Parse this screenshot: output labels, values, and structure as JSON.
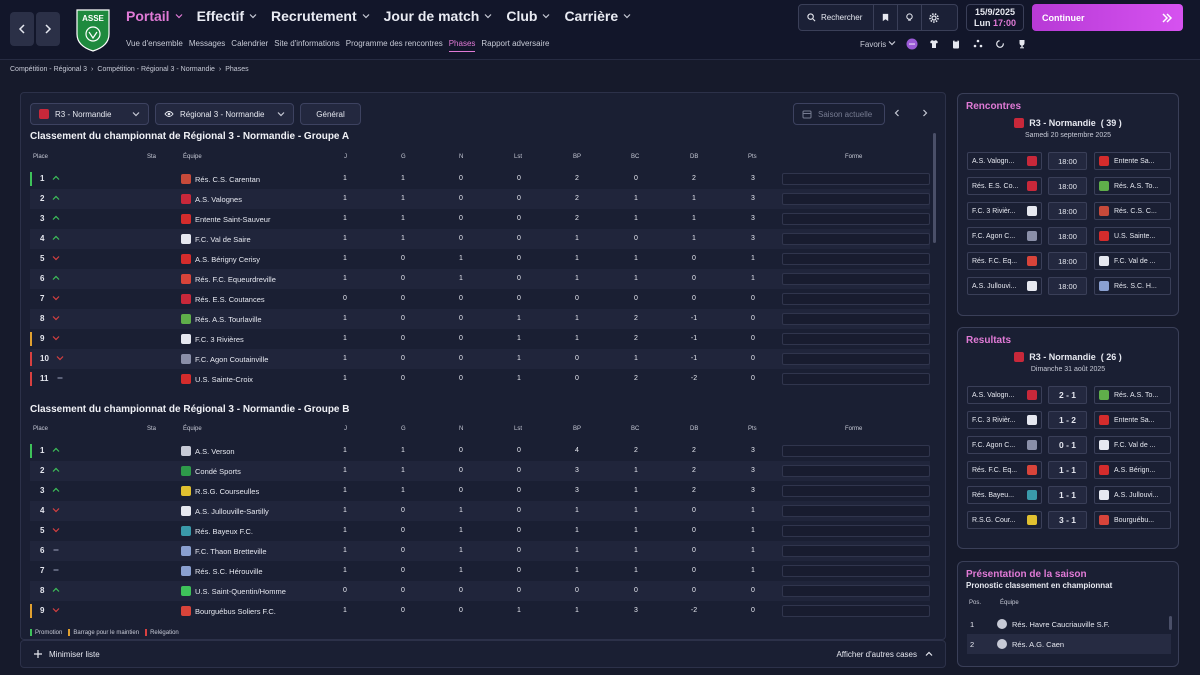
{
  "topbar": {
    "main_nav": [
      "Portail",
      "Effectif",
      "Recrutement",
      "Jour de match",
      "Club",
      "Carrière"
    ],
    "sub_nav": [
      "Vue d'ensemble",
      "Messages",
      "Calendrier",
      "Site d'informations",
      "Programme des rencontres",
      "Phases",
      "Rapport adversaire"
    ],
    "active_sub": "Phases",
    "search_label": "Rechercher",
    "date": "15/9/2025",
    "day_time": "Lun",
    "time": "17:00",
    "continue_label": "Continuer",
    "favoris_label": "Favoris",
    "logo_text": "ASSE"
  },
  "breadcrumb": [
    "Compétition - Régional 3",
    "Compétition - Régional 3 - Normandie",
    "Phases"
  ],
  "filters": {
    "comp": "R3 - Normandie",
    "view": "Régional 3 - Normandie",
    "mode": "Général",
    "season": "Saison actuelle"
  },
  "columns": [
    "Place",
    "Sta",
    "Équipe",
    "J",
    "G",
    "N",
    "Lst",
    "BP",
    "BC",
    "DB",
    "Pts",
    "Forme"
  ],
  "groupA": {
    "title": "Classement du championnat de Régional 3 - Normandie - Groupe A",
    "rows": [
      {
        "place": "1",
        "mv": "up",
        "bar": "#3ec25a",
        "team": "Rés. C.S. Carentan",
        "crest": "#c74a3a",
        "J": "1",
        "G": "1",
        "N": "0",
        "Lst": "0",
        "BP": "2",
        "BC": "0",
        "DB": "2",
        "Pts": "3"
      },
      {
        "place": "2",
        "mv": "up",
        "bar": "",
        "team": "A.S. Valognes",
        "crest": "#c8283a",
        "J": "1",
        "G": "1",
        "N": "0",
        "Lst": "0",
        "BP": "2",
        "BC": "1",
        "DB": "1",
        "Pts": "3"
      },
      {
        "place": "3",
        "mv": "up",
        "bar": "",
        "team": "Entente Saint-Sauveur",
        "crest": "#d42c2c",
        "J": "1",
        "G": "1",
        "N": "0",
        "Lst": "0",
        "BP": "2",
        "BC": "1",
        "DB": "1",
        "Pts": "3"
      },
      {
        "place": "4",
        "mv": "up",
        "bar": "",
        "team": "F.C. Val de Saire",
        "crest": "#e6e8f0",
        "J": "1",
        "G": "1",
        "N": "0",
        "Lst": "0",
        "BP": "1",
        "BC": "0",
        "DB": "1",
        "Pts": "3"
      },
      {
        "place": "5",
        "mv": "down",
        "bar": "",
        "team": "A.S. Bérigny Cerisy",
        "crest": "#d42c2c",
        "J": "1",
        "G": "0",
        "N": "1",
        "Lst": "0",
        "BP": "1",
        "BC": "1",
        "DB": "0",
        "Pts": "1"
      },
      {
        "place": "6",
        "mv": "up",
        "bar": "",
        "team": "Rés. F.C. Equeurdreville",
        "crest": "#d8443a",
        "J": "1",
        "G": "0",
        "N": "1",
        "Lst": "0",
        "BP": "1",
        "BC": "1",
        "DB": "0",
        "Pts": "1"
      },
      {
        "place": "7",
        "mv": "down",
        "bar": "",
        "team": "Rés. E.S. Coutances",
        "crest": "#c8283a",
        "J": "0",
        "G": "0",
        "N": "0",
        "Lst": "0",
        "BP": "0",
        "BC": "0",
        "DB": "0",
        "Pts": "0"
      },
      {
        "place": "8",
        "mv": "down",
        "bar": "",
        "team": "Rés. A.S. Tourlaville",
        "crest": "#5fae4a",
        "J": "1",
        "G": "0",
        "N": "0",
        "Lst": "1",
        "BP": "1",
        "BC": "2",
        "DB": "-1",
        "Pts": "0"
      },
      {
        "place": "9",
        "mv": "down",
        "bar": "#e0a030",
        "team": "F.C. 3 Rivières",
        "crest": "#e6e8f0",
        "J": "1",
        "G": "0",
        "N": "0",
        "Lst": "1",
        "BP": "1",
        "BC": "2",
        "DB": "-1",
        "Pts": "0"
      },
      {
        "place": "10",
        "mv": "down",
        "bar": "#d84040",
        "team": "F.C. Agon Coutainville",
        "crest": "#8a8fa8",
        "J": "1",
        "G": "0",
        "N": "0",
        "Lst": "1",
        "BP": "0",
        "BC": "1",
        "DB": "-1",
        "Pts": "0"
      },
      {
        "place": "11",
        "mv": "same",
        "bar": "#d84040",
        "team": "U.S. Sainte-Croix",
        "crest": "#d42c2c",
        "J": "1",
        "G": "0",
        "N": "0",
        "Lst": "1",
        "BP": "0",
        "BC": "2",
        "DB": "-2",
        "Pts": "0"
      }
    ]
  },
  "groupB": {
    "title": "Classement du championnat de Régional 3 - Normandie - Groupe B",
    "rows": [
      {
        "place": "1",
        "mv": "up",
        "bar": "#3ec25a",
        "team": "A.S. Verson",
        "crest": "#c7cad6",
        "J": "1",
        "G": "1",
        "N": "0",
        "Lst": "0",
        "BP": "4",
        "BC": "2",
        "DB": "2",
        "Pts": "3"
      },
      {
        "place": "2",
        "mv": "up",
        "bar": "",
        "team": "Condé Sports",
        "crest": "#2e9a4a",
        "J": "1",
        "G": "1",
        "N": "0",
        "Lst": "0",
        "BP": "3",
        "BC": "1",
        "DB": "2",
        "Pts": "3"
      },
      {
        "place": "3",
        "mv": "up",
        "bar": "",
        "team": "R.S.G. Courseulles",
        "crest": "#e0c030",
        "J": "1",
        "G": "1",
        "N": "0",
        "Lst": "0",
        "BP": "3",
        "BC": "1",
        "DB": "2",
        "Pts": "3"
      },
      {
        "place": "4",
        "mv": "down",
        "bar": "",
        "team": "A.S. Jullouville-Sartilly",
        "crest": "#e6e8f0",
        "J": "1",
        "G": "0",
        "N": "1",
        "Lst": "0",
        "BP": "1",
        "BC": "1",
        "DB": "0",
        "Pts": "1"
      },
      {
        "place": "5",
        "mv": "down",
        "bar": "",
        "team": "Rés. Bayeux F.C.",
        "crest": "#3a9aaa",
        "J": "1",
        "G": "0",
        "N": "1",
        "Lst": "0",
        "BP": "1",
        "BC": "1",
        "DB": "0",
        "Pts": "1"
      },
      {
        "place": "6",
        "mv": "same",
        "bar": "",
        "team": "F.C. Thaon Bretteville",
        "crest": "#8aa0d0",
        "J": "1",
        "G": "0",
        "N": "1",
        "Lst": "0",
        "BP": "1",
        "BC": "1",
        "DB": "0",
        "Pts": "1"
      },
      {
        "place": "7",
        "mv": "same",
        "bar": "",
        "team": "Rés. S.C. Hérouville",
        "crest": "#8aa0d0",
        "J": "1",
        "G": "0",
        "N": "1",
        "Lst": "0",
        "BP": "1",
        "BC": "1",
        "DB": "0",
        "Pts": "1"
      },
      {
        "place": "8",
        "mv": "up",
        "bar": "",
        "team": "U.S. Saint-Quentin/Homme",
        "crest": "#3ec25a",
        "J": "0",
        "G": "0",
        "N": "0",
        "Lst": "0",
        "BP": "0",
        "BC": "0",
        "DB": "0",
        "Pts": "0"
      },
      {
        "place": "9",
        "mv": "down",
        "bar": "#e0a030",
        "team": "Bourguébus Soliers F.C.",
        "crest": "#d8443a",
        "J": "1",
        "G": "0",
        "N": "0",
        "Lst": "1",
        "BP": "1",
        "BC": "3",
        "DB": "-2",
        "Pts": "0"
      }
    ]
  },
  "legend": {
    "promotion": "Promotion",
    "barrage": "Barrage pour le maintien",
    "relegation": "Relégation"
  },
  "bottombar": {
    "minimize": "Minimiser liste",
    "more": "Afficher d'autres cases"
  },
  "rencontres": {
    "title": "Rencontres",
    "comp": "R3 - Normandie",
    "round": "( 39 )",
    "date": "Samedi 20 septembre 2025",
    "matches": [
      {
        "home": "A.S. Valogn...",
        "hc": "#c8283a",
        "mid": "18:00",
        "away": "Entente Sa...",
        "ac": "#d42c2c"
      },
      {
        "home": "Rés. E.S. Co...",
        "hc": "#c8283a",
        "mid": "18:00",
        "away": "Rés. A.S. To...",
        "ac": "#5fae4a"
      },
      {
        "home": "F.C. 3 Rivièr...",
        "hc": "#e6e8f0",
        "mid": "18:00",
        "away": "Rés. C.S. C...",
        "ac": "#c74a3a"
      },
      {
        "home": "F.C. Agon C...",
        "hc": "#8a8fa8",
        "mid": "18:00",
        "away": "U.S. Sainte...",
        "ac": "#d42c2c"
      },
      {
        "home": "Rés. F.C. Eq...",
        "hc": "#d8443a",
        "mid": "18:00",
        "away": "F.C. Val de ...",
        "ac": "#e6e8f0"
      },
      {
        "home": "A.S. Jullouvi...",
        "hc": "#e6e8f0",
        "mid": "18:00",
        "away": "Rés. S.C. H...",
        "ac": "#8aa0d0"
      }
    ]
  },
  "resultats": {
    "title": "Resultats",
    "comp": "R3 - Normandie",
    "round": "( 26 )",
    "date": "Dimanche 31 août 2025",
    "matches": [
      {
        "home": "A.S. Valogn...",
        "hc": "#c8283a",
        "mid": "2 - 1",
        "away": "Rés. A.S. To...",
        "ac": "#5fae4a"
      },
      {
        "home": "F.C. 3 Rivièr...",
        "hc": "#e6e8f0",
        "mid": "1 - 2",
        "away": "Entente Sa...",
        "ac": "#d42c2c"
      },
      {
        "home": "F.C. Agon C...",
        "hc": "#8a8fa8",
        "mid": "0 - 1",
        "away": "F.C. Val de ...",
        "ac": "#e6e8f0"
      },
      {
        "home": "Rés. F.C. Eq...",
        "hc": "#d8443a",
        "mid": "1 - 1",
        "away": "A.S. Bérign...",
        "ac": "#d42c2c"
      },
      {
        "home": "Rés. Bayeu...",
        "hc": "#3a9aaa",
        "mid": "1 - 1",
        "away": "A.S. Jullouvi...",
        "ac": "#e6e8f0"
      },
      {
        "home": "R.S.G. Cour...",
        "hc": "#e0c030",
        "mid": "3 - 1",
        "away": "Bourguébu...",
        "ac": "#d8443a"
      }
    ]
  },
  "presentation": {
    "title": "Présentation de la saison",
    "subtitle": "Pronostic classement en championnat",
    "col_pos": "Pos.",
    "col_team": "Équipe",
    "rows": [
      {
        "pos": "1",
        "team": "Rés. Havre Caucriauville S.F.",
        "crest": "#c7cad6"
      },
      {
        "pos": "2",
        "team": "Rés. A.G. Caen",
        "crest": "#c7cad6"
      }
    ]
  },
  "colors": {
    "accent": "#e07ad6",
    "promotion": "#3ec25a",
    "barrage": "#e0a030",
    "relegation": "#d84040",
    "background": "#161a2b"
  }
}
